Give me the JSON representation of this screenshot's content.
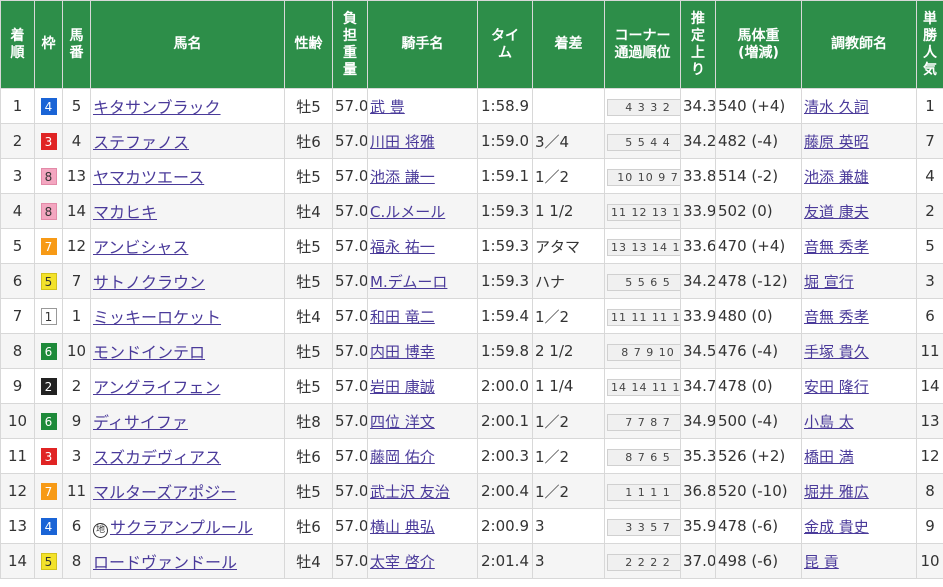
{
  "headers": {
    "rank": "着\n順",
    "waku": "枠",
    "umaban": "馬\n番",
    "horse": "馬名",
    "sexage": "性齢",
    "weight": "負\n担\n重\n量",
    "jockey": "騎手名",
    "time": "タイ\nム",
    "margin": "着差",
    "corner": "コーナー\n通過順位",
    "last3f": "推\n定\n上\nり",
    "bodyweight": "馬体重\n(増減)",
    "trainer": "調教師名",
    "pop": "単\n勝\n人\n気"
  },
  "rows": [
    {
      "rank": "1",
      "waku": "4",
      "umaban": "5",
      "marker": "",
      "horse": "キタサンブラック",
      "sexage": "牡5",
      "weight": "57.0",
      "jockey": "武 豊",
      "time": "1:58.9",
      "margin": "",
      "corner": "4 3 3 2",
      "last3f": "34.3",
      "bodyweight": "540 (+4)",
      "trainer": "清水 久詞",
      "pop": "1"
    },
    {
      "rank": "2",
      "waku": "3",
      "umaban": "4",
      "marker": "",
      "horse": "ステファノス",
      "sexage": "牡6",
      "weight": "57.0",
      "jockey": "川田 将雅",
      "time": "1:59.0",
      "margin": "3／4",
      "corner": "5 5 4 4",
      "last3f": "34.2",
      "bodyweight": "482 (-4)",
      "trainer": "藤原 英昭",
      "pop": "7"
    },
    {
      "rank": "3",
      "waku": "8",
      "umaban": "13",
      "marker": "",
      "horse": "ヤマカツエース",
      "sexage": "牡5",
      "weight": "57.0",
      "jockey": "池添 謙一",
      "time": "1:59.1",
      "margin": "1／2",
      "corner": "10 10 9 7",
      "last3f": "33.8",
      "bodyweight": "514 (-2)",
      "trainer": "池添 兼雄",
      "pop": "4"
    },
    {
      "rank": "4",
      "waku": "8",
      "umaban": "14",
      "marker": "",
      "horse": "マカヒキ",
      "sexage": "牡4",
      "weight": "57.0",
      "jockey": "C.ルメール",
      "time": "1:59.3",
      "margin": "1 1/2",
      "corner": "11 12 13 10",
      "last3f": "33.9",
      "bodyweight": "502 (0)",
      "trainer": "友道 康夫",
      "pop": "2"
    },
    {
      "rank": "5",
      "waku": "7",
      "umaban": "12",
      "marker": "",
      "horse": "アンビシャス",
      "sexage": "牡5",
      "weight": "57.0",
      "jockey": "福永 祐一",
      "time": "1:59.3",
      "margin": "アタマ",
      "corner": "13 13 14 13",
      "last3f": "33.6",
      "bodyweight": "470 (+4)",
      "trainer": "音無 秀孝",
      "pop": "5"
    },
    {
      "rank": "6",
      "waku": "5",
      "umaban": "7",
      "marker": "",
      "horse": "サトノクラウン",
      "sexage": "牡5",
      "weight": "57.0",
      "jockey": "M.デムーロ",
      "time": "1:59.3",
      "margin": "ハナ",
      "corner": "5 5 6 5",
      "last3f": "34.2",
      "bodyweight": "478 (-12)",
      "trainer": "堀 宣行",
      "pop": "3"
    },
    {
      "rank": "7",
      "waku": "1",
      "umaban": "1",
      "marker": "",
      "horse": "ミッキーロケット",
      "sexage": "牡4",
      "weight": "57.0",
      "jockey": "和田 竜二",
      "time": "1:59.4",
      "margin": "1／2",
      "corner": "11 11 11 13",
      "last3f": "33.9",
      "bodyweight": "480 (0)",
      "trainer": "音無 秀孝",
      "pop": "6"
    },
    {
      "rank": "8",
      "waku": "6",
      "umaban": "10",
      "marker": "",
      "horse": "モンドインテロ",
      "sexage": "牡5",
      "weight": "57.0",
      "jockey": "内田 博幸",
      "time": "1:59.8",
      "margin": "2 1/2",
      "corner": "8 7 9 10",
      "last3f": "34.5",
      "bodyweight": "476 (-4)",
      "trainer": "手塚 貴久",
      "pop": "11"
    },
    {
      "rank": "9",
      "waku": "2",
      "umaban": "2",
      "marker": "",
      "horse": "アングライフェン",
      "sexage": "牡5",
      "weight": "57.0",
      "jockey": "岩田 康誠",
      "time": "2:00.0",
      "margin": "1 1/4",
      "corner": "14 14 11 10",
      "last3f": "34.7",
      "bodyweight": "478 (0)",
      "trainer": "安田 隆行",
      "pop": "14"
    },
    {
      "rank": "10",
      "waku": "6",
      "umaban": "9",
      "marker": "",
      "horse": "ディサイファ",
      "sexage": "牡8",
      "weight": "57.0",
      "jockey": "四位 洋文",
      "time": "2:00.1",
      "margin": "1／2",
      "corner": "7 7 8 7",
      "last3f": "34.9",
      "bodyweight": "500 (-4)",
      "trainer": "小島 太",
      "pop": "13"
    },
    {
      "rank": "11",
      "waku": "3",
      "umaban": "3",
      "marker": "",
      "horse": "スズカデヴィアス",
      "sexage": "牡6",
      "weight": "57.0",
      "jockey": "藤岡 佑介",
      "time": "2:00.3",
      "margin": "1／2",
      "corner": "8 7 6 5",
      "last3f": "35.3",
      "bodyweight": "526 (+2)",
      "trainer": "橋田 満",
      "pop": "12"
    },
    {
      "rank": "12",
      "waku": "7",
      "umaban": "11",
      "marker": "",
      "horse": "マルターズアポジー",
      "sexage": "牡5",
      "weight": "57.0",
      "jockey": "武士沢 友治",
      "time": "2:00.4",
      "margin": "1／2",
      "corner": "1 1 1 1",
      "last3f": "36.8",
      "bodyweight": "520 (-10)",
      "trainer": "堀井 雅広",
      "pop": "8"
    },
    {
      "rank": "13",
      "waku": "4",
      "umaban": "6",
      "marker": "㋞",
      "horse": "サクラアンプルール",
      "sexage": "牡6",
      "weight": "57.0",
      "jockey": "横山 典弘",
      "time": "2:00.9",
      "margin": "3",
      "corner": "3 3 5 7",
      "last3f": "35.9",
      "bodyweight": "478 (-6)",
      "trainer": "金成 貴史",
      "pop": "9"
    },
    {
      "rank": "14",
      "waku": "5",
      "umaban": "8",
      "marker": "",
      "horse": "ロードヴァンドール",
      "sexage": "牡4",
      "weight": "57.0",
      "jockey": "太宰 啓介",
      "time": "2:01.4",
      "margin": "3",
      "corner": "2 2 2 2",
      "last3f": "37.0",
      "bodyweight": "498 (-6)",
      "trainer": "昆 貢",
      "pop": "10"
    }
  ],
  "colors": {
    "header_bg": "#2d8e49",
    "link": "#4a3a9a",
    "waku1": "#ffffff",
    "waku2": "#222222",
    "waku3": "#e02424",
    "waku4": "#1a64d6",
    "waku5": "#f3e22a",
    "waku6": "#1e8a3a",
    "waku7": "#f79a16",
    "waku8": "#f3a6c0"
  }
}
